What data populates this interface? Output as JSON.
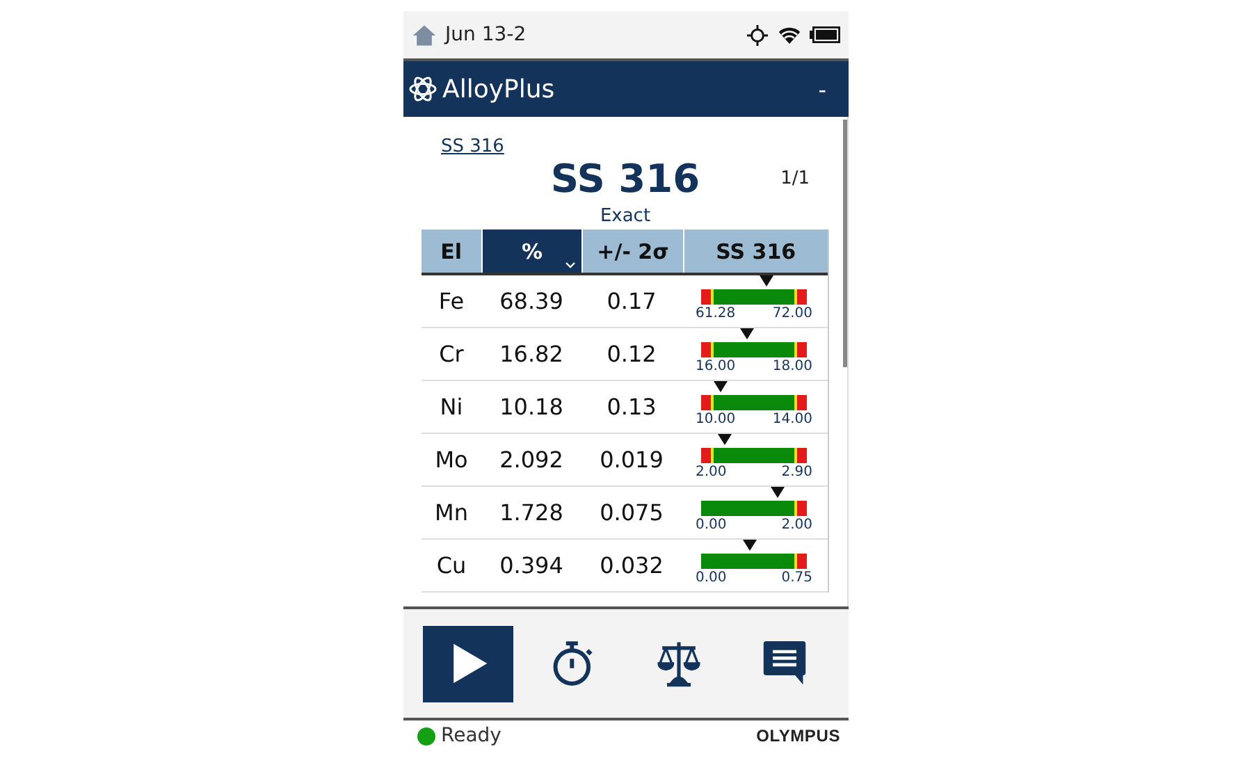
{
  "status_bar": {
    "title": "Jun 13-2"
  },
  "app_bar": {
    "title": "AlloyPlus",
    "menu": "-"
  },
  "result": {
    "link": "SS 316",
    "grade": "SS 316",
    "page": "1/1",
    "match": "Exact"
  },
  "table": {
    "columns": [
      {
        "label": "El",
        "selected": false
      },
      {
        "label": "%",
        "selected": true
      },
      {
        "label": "+/- 2σ",
        "selected": false
      },
      {
        "label": "SS 316",
        "selected": false
      }
    ],
    "rows": [
      {
        "element": "Fe",
        "percent": "68.39",
        "error": "0.17",
        "kind": "two-sided",
        "level": 0.63,
        "min": "61.28",
        "max": "72.00"
      },
      {
        "element": "Cr",
        "percent": "16.82",
        "error": "0.12",
        "kind": "two-sided",
        "level": 0.43,
        "min": "16.00",
        "max": "18.00"
      },
      {
        "element": "Ni",
        "percent": "10.18",
        "error": "0.13",
        "kind": "two-sided",
        "level": 0.14,
        "min": "10.00",
        "max": "14.00"
      },
      {
        "element": "Mo",
        "percent": "2.092",
        "error": "0.019",
        "kind": "two-sided",
        "level": 0.18,
        "min": "2.00",
        "max": "2.90"
      },
      {
        "element": "Mn",
        "percent": "1.728",
        "error": "0.075",
        "kind": "upper-only",
        "level": 0.76,
        "min": "0.00",
        "max": "2.00"
      },
      {
        "element": "Cu",
        "percent": "0.394",
        "error": "0.032",
        "kind": "upper-only",
        "level": 0.46,
        "min": "0.00",
        "max": "0.75"
      }
    ]
  },
  "toolbar": [
    {
      "kind": "play",
      "selected": true
    },
    {
      "kind": "timer",
      "selected": false
    },
    {
      "kind": "scale",
      "selected": false
    },
    {
      "kind": "message",
      "selected": false
    }
  ],
  "footer": {
    "status": "Ready",
    "brand": "OLYMPUS"
  }
}
